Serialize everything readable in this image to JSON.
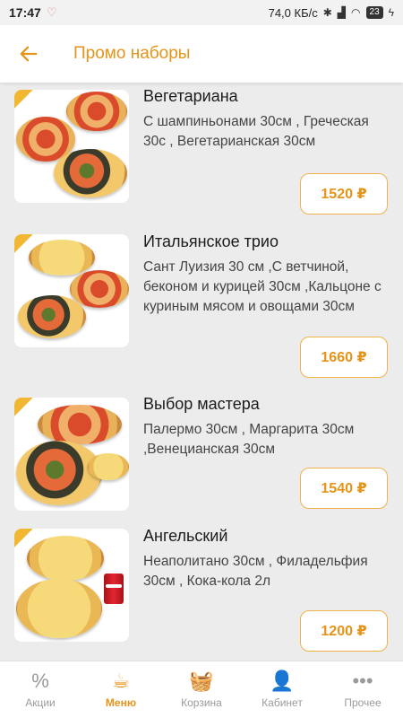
{
  "status_bar": {
    "time": "17:47",
    "network_speed": "74,0 КБ/с",
    "battery": "23"
  },
  "header": {
    "title": "Промо наборы"
  },
  "items": [
    {
      "name": "Вегетариана",
      "description": "С шампиньонами 30см , Греческая 30с , Вегетарианская 30см",
      "price": "1520 ₽"
    },
    {
      "name": "Итальянское трио",
      "description": "Сант Луизия 30 см ,С ветчиной, беконом и курицей 30см ,Кальцоне с куриным мясом и овощами 30см",
      "price": "1660 ₽"
    },
    {
      "name": "Выбор мастера",
      "description": "Палермо 30см , Маргарита 30см ,Венецианская 30см",
      "price": "1540 ₽"
    },
    {
      "name": "Ангельский",
      "description": "Неаполитано 30см , Филадельфия 30см  , Кока-кола 2л",
      "price": "1200 ₽"
    }
  ],
  "bottom_nav": [
    {
      "label": "Акции",
      "icon": "percent-icon"
    },
    {
      "label": "Меню",
      "icon": "menu-food-icon"
    },
    {
      "label": "Корзина",
      "icon": "basket-icon"
    },
    {
      "label": "Кабинет",
      "icon": "user-icon"
    },
    {
      "label": "Прочее",
      "icon": "more-icon"
    }
  ],
  "colors": {
    "accent": "#e69319",
    "background": "#ececec"
  }
}
